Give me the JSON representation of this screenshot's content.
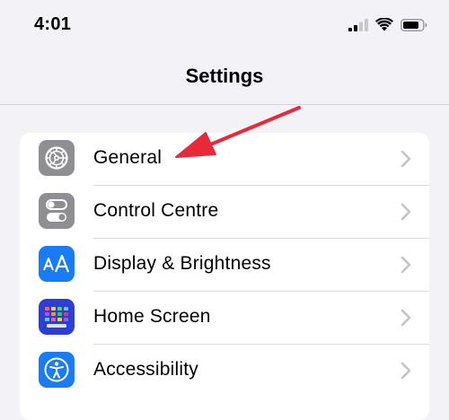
{
  "status_bar": {
    "time": "4:01",
    "icons": [
      "cellular-signal-icon",
      "wifi-icon",
      "battery-icon"
    ]
  },
  "nav": {
    "title": "Settings"
  },
  "settings": {
    "items": [
      {
        "label": "General",
        "icon": "gear-icon",
        "icon_color": "#8e8e93"
      },
      {
        "label": "Control Centre",
        "icon": "toggle-switches-icon",
        "icon_color": "#8e8e93"
      },
      {
        "label": "Display & Brightness",
        "icon": "text-size-aa-icon",
        "icon_color": "#1a7cf5"
      },
      {
        "label": "Home Screen",
        "icon": "app-grid-icon",
        "icon_color": "#2b3ed6"
      },
      {
        "label": "Accessibility",
        "icon": "accessibility-person-icon",
        "icon_color": "#1a7cf5"
      }
    ]
  },
  "annotation": {
    "arrow_color": "#e8293a",
    "points_to": "General"
  },
  "colors": {
    "background": "#f2f2f7",
    "card": "#ffffff",
    "chevron": "#c4c4c7"
  }
}
